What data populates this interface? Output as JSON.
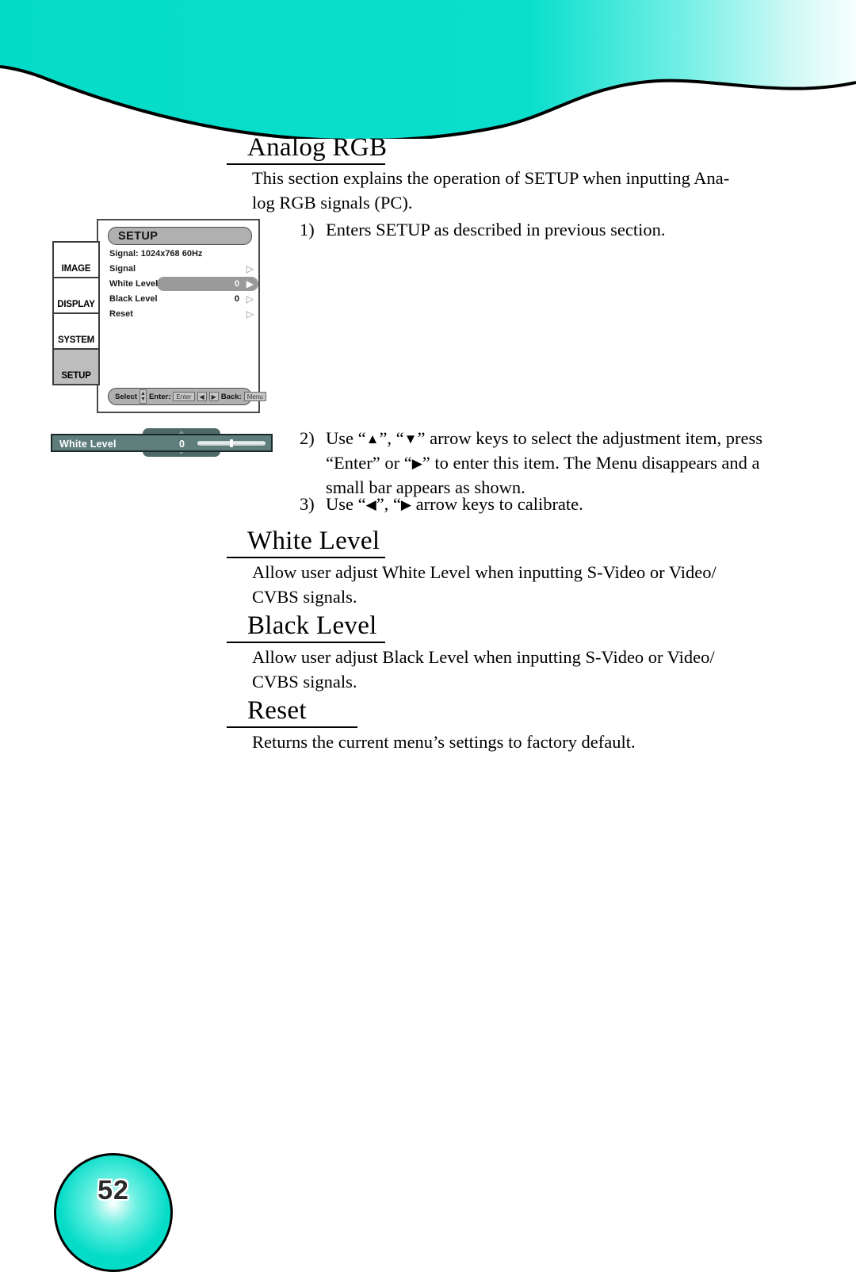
{
  "page": {
    "number": "52"
  },
  "sections": [
    {
      "id": "analog-rgb",
      "heading": "Analog RGB",
      "body": "This section explains the operation of SETUP when inputting Analog RGB signals (PC)."
    },
    {
      "id": "white-level",
      "heading": "White Level",
      "body": "Allow user adjust White Level when inputting S-Video or Video/ CVBS signals."
    },
    {
      "id": "black-level",
      "heading": "Black Level",
      "body": "Allow user adjust Black Level when inputting S-Video or Video/ CVBS signals."
    },
    {
      "id": "reset",
      "heading": "Reset",
      "body": "Returns the current menu's settings to factory default."
    }
  ],
  "intro": {
    "line1": "This section explains the operation of SETUP when inputting Ana-",
    "line2": "log RGB signals (PC)."
  },
  "steps": [
    {
      "number": "1)",
      "text": "Enters SETUP as described in previous section."
    },
    {
      "number": "2)",
      "prefix": "Use “",
      "glyph1": "▲",
      "mid1": "”, “",
      "glyph2": "▼",
      "mid2": "” arrow keys to select the adjustment item, press “Enter” or “",
      "glyph3": "▶",
      "suffix": "” to enter this item. The Menu disappears and a small bar appears as shown."
    },
    {
      "number": "3)",
      "prefix": "Use “",
      "glyph1": "◀",
      "mid1": "”, “",
      "glyph2": "▶",
      "suffix": " arrow keys to calibrate."
    }
  ],
  "white_level_body": {
    "line1": "Allow user adjust White Level when inputting S-Video or Video/",
    "line2": "CVBS signals."
  },
  "black_level_body": {
    "line1": "Allow user adjust Black Level when inputting S-Video or Video/",
    "line2": "CVBS signals."
  },
  "reset_body": {
    "line1": "Returns the current menu’s settings to factory default."
  },
  "osd": {
    "title": "SETUP",
    "signal_info": "Signal: 1024x768 60Hz",
    "tabs": [
      {
        "label": "IMAGE",
        "active": false
      },
      {
        "label": "DISPLAY",
        "active": false
      },
      {
        "label": "SYSTEM",
        "active": false
      },
      {
        "label": "SETUP",
        "active": true
      }
    ],
    "rows": [
      {
        "name": "Signal",
        "value": "",
        "selected": false
      },
      {
        "name": "White Level",
        "value": "0",
        "selected": true
      },
      {
        "name": "Black Level",
        "value": "0",
        "selected": false
      },
      {
        "name": "Reset",
        "value": "",
        "selected": false
      }
    ],
    "hint": {
      "select_label": "Select",
      "enter_label": "Enter:",
      "enter_key": "Enter",
      "left_key": "◀",
      "right_key": "▶",
      "back_label": "Back:",
      "back_key": "Menu",
      "up_glyph": "▲",
      "down_glyph": "▼"
    },
    "arrow_glyph": "▷",
    "arrow_glyph_selected": "▶"
  },
  "adjust_bar": {
    "label": "White Level",
    "value": "0"
  },
  "colors": {
    "teal": "#05dcc8",
    "osd_highlight": "#9a9a9a",
    "bar_background": "#5f7d7b"
  }
}
